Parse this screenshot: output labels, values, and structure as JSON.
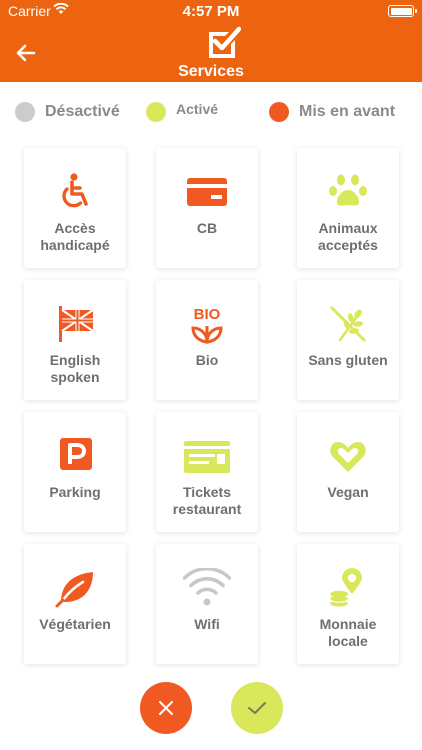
{
  "status_bar": {
    "carrier": "Carrier",
    "time": "4:57 PM"
  },
  "header": {
    "title": "Services",
    "back_icon": "arrow-left-icon",
    "title_icon": "checkbox-icon"
  },
  "legend": [
    {
      "label": "Désactivé",
      "color": "#cccccc"
    },
    {
      "label": "Activé",
      "color": "#d8e85a"
    },
    {
      "label": "Mis en avant",
      "color": "#f05a22"
    }
  ],
  "services": [
    {
      "label_line1": "Accès",
      "label_line2": "handicapé",
      "state": "Mis en avant",
      "icon": "wheelchair-icon"
    },
    {
      "label_line1": "CB",
      "label_line2": "",
      "state": "Mis en avant",
      "icon": "credit-card-icon"
    },
    {
      "label_line1": "Animaux",
      "label_line2": "acceptés",
      "state": "Activé",
      "icon": "paw-icon"
    },
    {
      "label_line1": "English",
      "label_line2": "spoken",
      "state": "Mis en avant",
      "icon": "uk-flag-icon"
    },
    {
      "label_line1": "Bio",
      "label_line2": "",
      "state": "Mis en avant",
      "icon": "bio-leaf-icon"
    },
    {
      "label_line1": "Sans gluten",
      "label_line2": "",
      "state": "Activé",
      "icon": "gluten-free-icon"
    },
    {
      "label_line1": "Parking",
      "label_line2": "",
      "state": "Mis en avant",
      "icon": "parking-icon"
    },
    {
      "label_line1": "Tickets",
      "label_line2": "restaurant",
      "state": "Activé",
      "icon": "ticket-icon"
    },
    {
      "label_line1": "Vegan",
      "label_line2": "",
      "state": "Activé",
      "icon": "heart-icon"
    },
    {
      "label_line1": "Végétarien",
      "label_line2": "",
      "state": "Mis en avant",
      "icon": "leaf-icon"
    },
    {
      "label_line1": "Wifi",
      "label_line2": "",
      "state": "Désactivé",
      "icon": "wifi-icon"
    },
    {
      "label_line1": "Monnaie",
      "label_line2": "locale",
      "state": "Activé",
      "icon": "local-currency-icon"
    }
  ],
  "actions": {
    "cancel_icon": "close-icon",
    "confirm_icon": "check-icon"
  },
  "colors": {
    "header": "#ec640f",
    "highlighted": "#f05a22",
    "active": "#d8e85a",
    "disabled": "#cccccc",
    "label": "#6f6f6f"
  }
}
